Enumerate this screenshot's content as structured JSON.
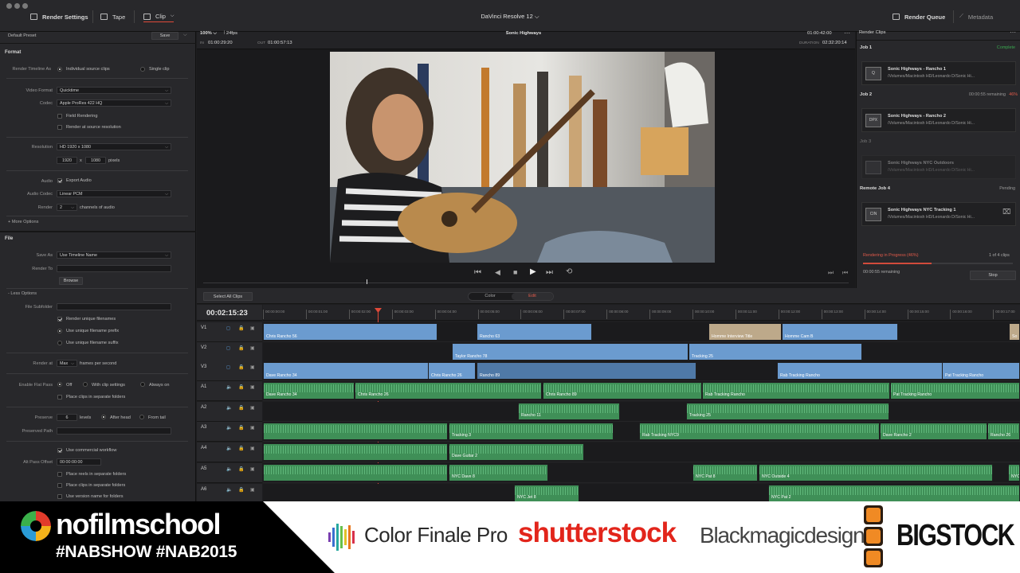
{
  "titlebar": {
    "app_title": "DaVinci Resolve 12",
    "tabs": [
      "Render Settings",
      "Tape",
      "Clip"
    ],
    "render_queue_label": "Render Queue",
    "metadata_label": "Metadata"
  },
  "settings": {
    "preset": "Default Preset",
    "save": "Save",
    "format_head": "Format",
    "render_timeline_as": "Render Timeline As",
    "opt_individual": "Individual source clips",
    "opt_single": "Single clip",
    "video_format_label": "Video Format",
    "video_format": "Quicktime",
    "codec_label": "Codec",
    "codec": "Apple ProRes 422 HQ",
    "field_rendering": "Field Rendering",
    "render_source_res": "Render at source resolution",
    "resolution_label": "Resolution",
    "resolution": "HD 1920 x 1080",
    "res_w": "1920",
    "res_x": "x",
    "res_h": "1080",
    "pixels": "pixels",
    "audio_label": "Audio",
    "export_audio": "Export Audio",
    "audio_codec_label": "Audio Codec",
    "audio_codec": "Linear PCM",
    "render_label": "Render",
    "channels": "2",
    "channels_of_audio": "channels of audio",
    "more_options": "+ More Options",
    "file_head": "File",
    "save_as_label": "Save As",
    "save_as": "Use Timeline Name",
    "render_to_label": "Render To",
    "browse": "Browse",
    "less_options": "- Less Options",
    "file_subfolder": "File Subfolder",
    "render_unique": "Render unique filenames",
    "unique_prefix": "Use unique filename prefix",
    "unique_suffix": "Use unique filename suffix",
    "render_at_label": "Render at",
    "render_at": "Max",
    "frames_per_second": "frames per second",
    "flat_pass_label": "Enable Flat Pass",
    "fp_off": "Off",
    "fp_clip": "With clip settings",
    "fp_always": "Always on",
    "place_clips": "Place clips in separate folders",
    "preserve_label": "Preserve",
    "preserve_levels_val": "6",
    "levels": "levels",
    "after_head": "After head",
    "from_tail": "From tail",
    "preserved_path": "Preserved Path",
    "commercial_workflow": "Use commercial workflow",
    "alt_pass_offset": "Alt Pass Offset",
    "alt_offset_val": "00:00:00:00",
    "place_reels": "Place reels in separate folders",
    "place_clips2": "Place clips in separate folders",
    "version_name": "Use version name for folders"
  },
  "viewer": {
    "zoom": "100%",
    "fps": "24fps",
    "title": "Sonic Highways",
    "timecode_end": "01:00:42:00",
    "in_label": "IN",
    "in_tc": "01:00:29:20",
    "out_label": "OUT",
    "out_tc": "01:00:57:13",
    "duration_label": "DURATION",
    "duration": "02:32:20:14"
  },
  "render_queue": {
    "header": "Render Clips",
    "jobs": [
      {
        "label": "Job 1",
        "status": "Complete",
        "status_color": "#3aa84f",
        "thumb": "Q",
        "name": "Sonic Highways - Rancho 1",
        "path": "/Volumes/Macintosh HD/Leonardo D/Sonic Hi..."
      },
      {
        "label": "Job 2",
        "status": "00:00:55 remaining",
        "pct": "46%",
        "thumb": "DPX",
        "name": "Sonic Highways - Rancho 2",
        "path": "/Volumes/Macintosh HD/Leonardo D/Sonic Hi..."
      },
      {
        "label": "Job 3",
        "status": "",
        "thumb": "",
        "name": "Sonic Highways NYC Outdoors",
        "path": "/Volumes/Macintosh HD/Leonardo D/Sonic Hi..."
      },
      {
        "label": "Remote Job 4",
        "status": "Pending",
        "thumb": "CIN",
        "name": "Sonic Highways NYC Tracking 1",
        "path": "/Volumes/Macintosh HD/Leonardo D/Sonic Hi..."
      }
    ],
    "progress_text": "Rendering in Progress (46%)",
    "progress_fraction": 0.46,
    "progress_count": "1 of 4 clips",
    "remaining": "00:00:55 remaining",
    "stop": "Stop"
  },
  "timeline": {
    "select_all": "Select All Clips",
    "tab_color": "Color",
    "tab_edit": "Edit",
    "current_tc": "00:02:15:23",
    "ruler": [
      "00:00:00:00",
      "00:00:01:00",
      "00:00:02:00",
      "00:00:03:00",
      "00:00:04:00",
      "00:00:05:00",
      "00:00:06:00",
      "00:00:07:00",
      "00:00:08:00",
      "00:00:09:00",
      "00:00:10:00",
      "00:00:11:00",
      "00:00:12:00",
      "00:00:13:00",
      "00:00:14:00",
      "00:00:15:00",
      "00:00:16:00",
      "00:00:17:00"
    ],
    "tracks": [
      "V1",
      "V2",
      "V3",
      "A1",
      "A2",
      "A3",
      "A4",
      "A5",
      "A6"
    ],
    "clips": [
      {
        "track": 0,
        "name": "Chris Rancho 56",
        "kind": "v"
      },
      {
        "track": 0,
        "name": "Rancho 63",
        "kind": "v"
      },
      {
        "track": 0,
        "name": "Homme Interview Title",
        "kind": "tan"
      },
      {
        "track": 0,
        "name": "Homme Cam B",
        "kind": "v"
      },
      {
        "track": 0,
        "name": "So",
        "kind": "tan"
      },
      {
        "track": 1,
        "name": "Taylor Rancho 78",
        "kind": "v"
      },
      {
        "track": 1,
        "name": "Tracking 25",
        "kind": "v"
      },
      {
        "track": 2,
        "name": "Dave Rancho 34",
        "kind": "v"
      },
      {
        "track": 2,
        "name": "Chris Rancho 26",
        "kind": "v"
      },
      {
        "track": 2,
        "name": "Rancho 89",
        "kind": "dark"
      },
      {
        "track": 2,
        "name": "Rab Tracking Rancho",
        "kind": "v"
      },
      {
        "track": 2,
        "name": "Pat Tracking Rancho",
        "kind": "v"
      },
      {
        "track": 3,
        "name": "Dave Rancho 34",
        "kind": "a"
      },
      {
        "track": 3,
        "name": "Chris Rancho 26",
        "kind": "a"
      },
      {
        "track": 3,
        "name": "Chris Rancho 89",
        "kind": "a"
      },
      {
        "track": 3,
        "name": "Rab Tracking Rancho",
        "kind": "a"
      },
      {
        "track": 3,
        "name": "Pat Tracking Rancho",
        "kind": "a"
      },
      {
        "track": 4,
        "name": "Rancho 11",
        "kind": "a"
      },
      {
        "track": 4,
        "name": "Tracking 25",
        "kind": "a"
      },
      {
        "track": 5,
        "name": "",
        "kind": "a"
      },
      {
        "track": 5,
        "name": "Tracking 3",
        "kind": "a"
      },
      {
        "track": 5,
        "name": "Rab Tracking NYC9",
        "kind": "a"
      },
      {
        "track": 5,
        "name": "Dave Rancho 2",
        "kind": "a"
      },
      {
        "track": 5,
        "name": "Rancho 26",
        "kind": "a"
      },
      {
        "track": 6,
        "name": "",
        "kind": "a"
      },
      {
        "track": 6,
        "name": "Dave Guitar 2",
        "kind": "a"
      },
      {
        "track": 7,
        "name": "",
        "kind": "a"
      },
      {
        "track": 7,
        "name": "NYC Dave 8",
        "kind": "a"
      },
      {
        "track": 7,
        "name": "NYC Pat 8",
        "kind": "a"
      },
      {
        "track": 7,
        "name": "NYC Outside 4",
        "kind": "a"
      },
      {
        "track": 7,
        "name": "NYC J",
        "kind": "a"
      },
      {
        "track": 8,
        "name": "NYC Jet 8",
        "kind": "a"
      },
      {
        "track": 8,
        "name": "NYC Pat 2",
        "kind": "a"
      }
    ]
  },
  "banner": {
    "nfs_logo": "nofilmschool",
    "hashtags": "#NABSHOW #NAB2015",
    "sponsor1": "Color Finale Pro",
    "sponsor2": "shutterstock",
    "sponsor3": "Blackmagicdesign",
    "sponsor4": "BIGSTOCK"
  }
}
